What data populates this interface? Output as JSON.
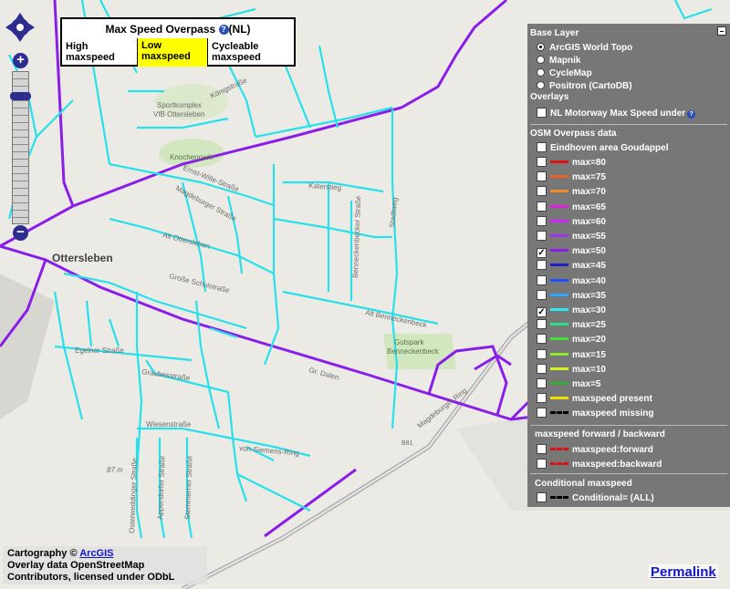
{
  "legend": {
    "title": "Max Speed Overpass",
    "title_suffix": "(NL)",
    "info_glyph": "?",
    "high_label": "High maxspeed",
    "low_label": "Low maxspeed",
    "cycle_label": "Cycleable maxspeed"
  },
  "nav": {
    "zoom_in": "+",
    "zoom_out": "−"
  },
  "layers": {
    "base_header": "Base Layer",
    "base_options": [
      {
        "label": "ArcGIS World Topo",
        "selected": true
      },
      {
        "label": "Mapnik",
        "selected": false
      },
      {
        "label": "CycleMap",
        "selected": false
      },
      {
        "label": "Positron (CartoDB)",
        "selected": false
      }
    ],
    "overlays_header": "Overlays",
    "nl_motorway": "NL Motorway Max Speed under",
    "osm_header": "OSM Overpass data",
    "eindhoven": "Eindhoven area Goudappel",
    "speeds": [
      {
        "label": "max=80",
        "color": "#e01010",
        "checked": false
      },
      {
        "label": "max=75",
        "color": "#f06020",
        "checked": false
      },
      {
        "label": "max=70",
        "color": "#f08c28",
        "checked": false
      },
      {
        "label": "max=65",
        "color": "#e020e0",
        "checked": false
      },
      {
        "label": "max=60",
        "color": "#d028ff",
        "checked": false
      },
      {
        "label": "max=55",
        "color": "#a030f0",
        "checked": false
      },
      {
        "label": "max=50",
        "color": "#8a1ee8",
        "checked": true
      },
      {
        "label": "max=45",
        "color": "#2020c8",
        "checked": false
      },
      {
        "label": "max=40",
        "color": "#1e50ff",
        "checked": false
      },
      {
        "label": "max=35",
        "color": "#28a8ff",
        "checked": false
      },
      {
        "label": "max=30",
        "color": "#28e8f0",
        "checked": true
      },
      {
        "label": "max=25",
        "color": "#28e088",
        "checked": false
      },
      {
        "label": "max=20",
        "color": "#40e040",
        "checked": false
      },
      {
        "label": "max=15",
        "color": "#90e828",
        "checked": false
      },
      {
        "label": "max=10",
        "color": "#d8f020",
        "checked": false
      },
      {
        "label": "max=5",
        "color": "#30b030",
        "checked": false
      },
      {
        "label": "maxspeed present",
        "color": "#f0e000",
        "checked": false
      },
      {
        "label": "maxspeed missing",
        "color": "#000000",
        "checked": false
      }
    ],
    "fb_header": "maxspeed forward / backward",
    "fb_items": [
      {
        "label": "maxspeed:forward",
        "color": "#e01010"
      },
      {
        "label": "maxspeed:backward",
        "color": "#e01010"
      }
    ],
    "cond_header": "Conditional maxspeed",
    "cond_item": "Conditional= (ALL)"
  },
  "map_labels": {
    "town": "Ottersleben",
    "sport": "Sportkomplex",
    "sport2": "VfB Ottersleben",
    "knochenpark": "Knochenpark",
    "gutspark1": "Gutspark",
    "gutspark2": "Benneckenbeck",
    "road_b81": "B81",
    "elevation": "87 m",
    "streets": {
      "ernst_wille": "Ernst-Wille-Straße",
      "magdeburger": "Magdeburger Straße",
      "alt_ottersleben": "Alt Ottersleben",
      "grosse_schul": "Große Schulstraße",
      "alt_benneckenbeck": "Alt Benneckenbeck",
      "egelner": "Egelner Straße",
      "graubes": "Graubesstraße",
      "wiesenstrasse": "Wiesenstraße",
      "von_siemens": "von-Siemens-Ring",
      "gr_dalen": "Gr. Dalen",
      "magdeburger_ring": "Magdeburger Ring",
      "katerstieg": "Katerstieg",
      "benneckenbecker": "Benneckenbecker Straße",
      "stadtweg": "Stadtweg",
      "kroker": "Königstraße",
      "osterweddinger": "Osterweddinger Straße",
      "appendorfer": "Appendorfer Straße",
      "stemmerner": "Stemmerner Straße"
    }
  },
  "attribution": {
    "line1_prefix": "Cartography ©",
    "line1_link": "ArcGIS",
    "line2": "Overlay data OpenStreetMap",
    "line3": "Contributors, licensed under ODbL"
  },
  "permalink": "Permalink"
}
